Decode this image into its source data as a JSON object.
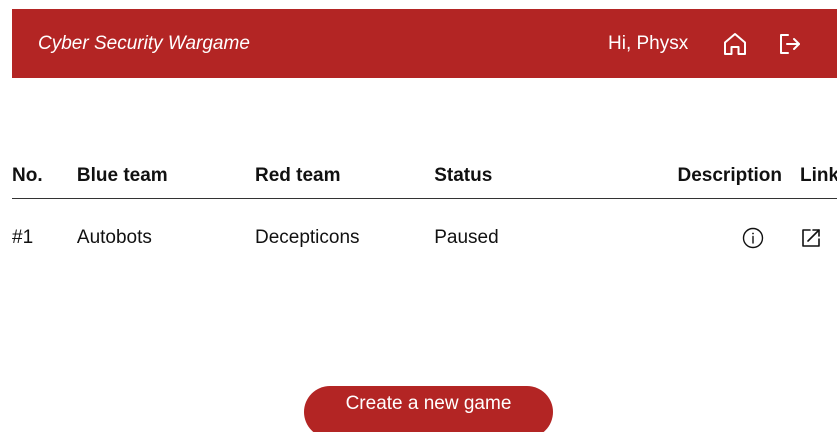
{
  "header": {
    "brand": "Cyber Security Wargame",
    "greeting": "Hi, Physx",
    "home_icon": "home-icon",
    "logout_icon": "logout-icon",
    "background_color": "#b32524",
    "text_color": "#ffffff"
  },
  "games_table": {
    "columns": [
      "No.",
      "Blue team",
      "Red team",
      "Status",
      "Description",
      "Link"
    ],
    "rows": [
      {
        "number": "#1",
        "blue_team": "Autobots",
        "red_team": "Decepticons",
        "status": "Paused",
        "description_icon": "info-icon",
        "link_icon": "open-link-icon"
      }
    ]
  },
  "actions": {
    "create_label": "Create a new game",
    "button_color": "#b32524"
  }
}
